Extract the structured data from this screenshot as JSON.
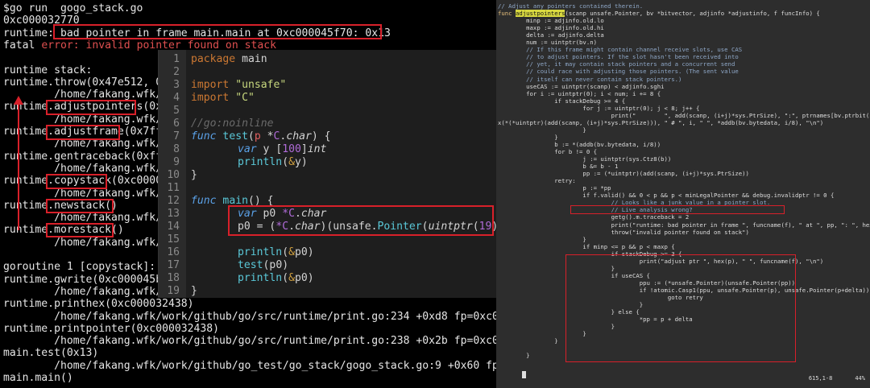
{
  "terminal": {
    "lines": [
      "$go run  gogo_stack.go",
      "0xc000032770",
      "runtime: bad pointer in frame main.main at 0xc000045f70: 0x13",
      "fatal error: invalid pointer found on stack",
      "",
      "runtime stack:",
      "runtime.throw(0x47e512, 0x",
      "        /home/fakang.wfk/w",
      "runtime.adjustpointers(0xc",
      "        /home/fakang.wfk/w",
      "runtime.adjustframe(0x7fff",
      "        /home/fakang.wfk/w",
      "runtime.gentraceback(0xfff",
      "        /home/fakang.wfk/w",
      "runtime.copystack(0xc00000",
      "        /home/fakang.wfk/w",
      "runtime.newstack()",
      "        /home/fakang.wfk/w",
      "runtime.morestack()",
      "        /home/fakang.wfk/w",
      "",
      "goroutine 1 [copystack]:",
      "runtime.gwrite(0xc000045bf",
      "        /home/fakang.wfk/w",
      "runtime.printhex(0xc000032438)",
      "        /home/fakang.wfk/work/github/go/src/runtime/print.go:234 +0xd8 fp=0xc000045",
      "runtime.printpointer(0xc000032438)",
      "        /home/fakang.wfk/work/github/go/src/runtime/print.go:238 +0x2b fp=0xc000045",
      "main.test(0x13)",
      "        /home/fakang.wfk/work/github/go_test/go_stack/gogo_stack.go:9 +0x60 fp=0xc0",
      "main.main()"
    ],
    "fatal_prefix": "fatal ",
    "fatal_error_word": "error:",
    "fatal_rest": " invalid pointer found on stack"
  },
  "editor": {
    "line_numbers": [
      "1",
      "2",
      "3",
      "4",
      "5",
      "6",
      "7",
      "8",
      "9",
      "10",
      "11",
      "12",
      "13",
      "14",
      "15",
      "16",
      "17",
      "18",
      "19"
    ],
    "code": {
      "l1_kw": "package",
      "l1_rest": " main",
      "l3_kw": "import",
      "l3_str": " \"unsafe\"",
      "l4_kw": "import",
      "l4_str": " \"C\"",
      "l6": "//go:noinline",
      "l7_kw": "func",
      "l7_name": " test",
      "l7_a": "(",
      "l7_p": "p",
      "l7_b": " *",
      "l7_c": "C",
      "l7_d": ".",
      "l7_t": "char",
      "l7_e": ") {",
      "l8_kw": "var",
      "l8_rest": " y ",
      "l8_br": "[",
      "l8_n": "100",
      "l8_br2": "]",
      "l8_t": "int",
      "l9_fn": "println",
      "l9_a": "(",
      "l9_ref": "&",
      "l9_v": "y",
      "l9_b": ")",
      "l10": "}",
      "l12_kw": "func",
      "l12_name": " main",
      "l12_rest": "() {",
      "l13_kw": "var",
      "l13_rest": " p0 ",
      "l13_c": "*C",
      "l13_d": ".",
      "l13_t": "char",
      "l14_a": "p0 = (",
      "l14_c": "*C",
      "l14_d": ".",
      "l14_t": "char",
      "l14_e": ")(unsafe.",
      "l14_fn": "Pointer",
      "l14_f": "(",
      "l14_u": "uintptr",
      "l14_g": "(",
      "l14_n": "19",
      "l14_h": ")))",
      "l16_fn": "println",
      "l16_a": "(",
      "l16_ref": "&",
      "l16_v": "p0",
      "l16_b": ")",
      "l17_fn": "test",
      "l17_rest": "(p0)",
      "l18_fn": "println",
      "l18_a": "(",
      "l18_ref": "&",
      "l18_v": "p0",
      "l18_b": ")",
      "l19": "}"
    }
  },
  "source": {
    "lines": [
      "// Adjust any pointers contained therein.",
      "func adjustpointers(scanp unsafe.Pointer, bv *bitvector, adjinfo *adjustinfo, f funcInfo) {",
      "        minp := adjinfo.old.lo",
      "        maxp := adjinfo.old.hi",
      "        delta := adjinfo.delta",
      "        num := uintptr(bv.n)",
      "        // If this frame might contain channel receive slots, use CAS",
      "        // to adjust pointers. If the slot hasn't been received into",
      "        // yet, it may contain stack pointers and a concurrent send",
      "        // could race with adjusting those pointers. (The sent value",
      "        // itself can never contain stack pointers.)",
      "        useCAS := uintptr(scanp) < adjinfo.sghi",
      "        for i := uintptr(0); i < num; i += 8 {",
      "                if stackDebug >= 4 {",
      "                        for j := uintptr(0); j < 8; j++ {",
      "                                print(\"        \", add(scanp, (i+j)*sys.PtrSize), \":\", ptrnames[bv.ptrbit(i+j)], \":\", he",
      "x(*(*uintptr)(add(scanp, (i+j)*sys.PtrSize))), \" # \", i, \" \", *addb(bv.bytedata, i/8), \"\\n\")",
      "                        }",
      "                }",
      "                b := *(addb(bv.bytedata, i/8))",
      "                for b != 0 {",
      "                        j := uintptr(sys.Ctz8(b))",
      "                        b &= b - 1",
      "                        pp := (*uintptr)(add(scanp, (i+j)*sys.PtrSize))",
      "                retry:",
      "                        p := *pp",
      "                        if f.valid() && 0 < p && p < minLegalPointer && debug.invalidptr != 0 {",
      "                                // Looks like a junk value in a pointer slot.",
      "                                // Live analysis wrong?",
      "                                getg().m.traceback = 2",
      "                                print(\"runtime: bad pointer in frame \", funcname(f), \" at \", pp, \": \", hex(p), \"\\n\")",
      "                                throw(\"invalid pointer found on stack\")",
      "                        }",
      "                        if minp <= p && p < maxp {",
      "                                if stackDebug >= 3 {",
      "                                        print(\"adjust ptr \", hex(p), \" \", funcname(f), \"\\n\")",
      "                                }",
      "                                if useCAS {",
      "                                        ppu := (*unsafe.Pointer)(unsafe.Pointer(pp))",
      "                                        if !atomic.Casp1(ppu, unsafe.Pointer(p), unsafe.Pointer(p+delta)) {",
      "                                                goto retry",
      "                                        }",
      "                                } else {",
      "                                        *pp = p + delta",
      "                                }",
      "                        }",
      "                }",
      "",
      "        }",
      ""
    ],
    "func_kw": "func ",
    "func_name": "adjustpointers",
    "status_pos": "615,1-8",
    "status_pct": "44%"
  }
}
